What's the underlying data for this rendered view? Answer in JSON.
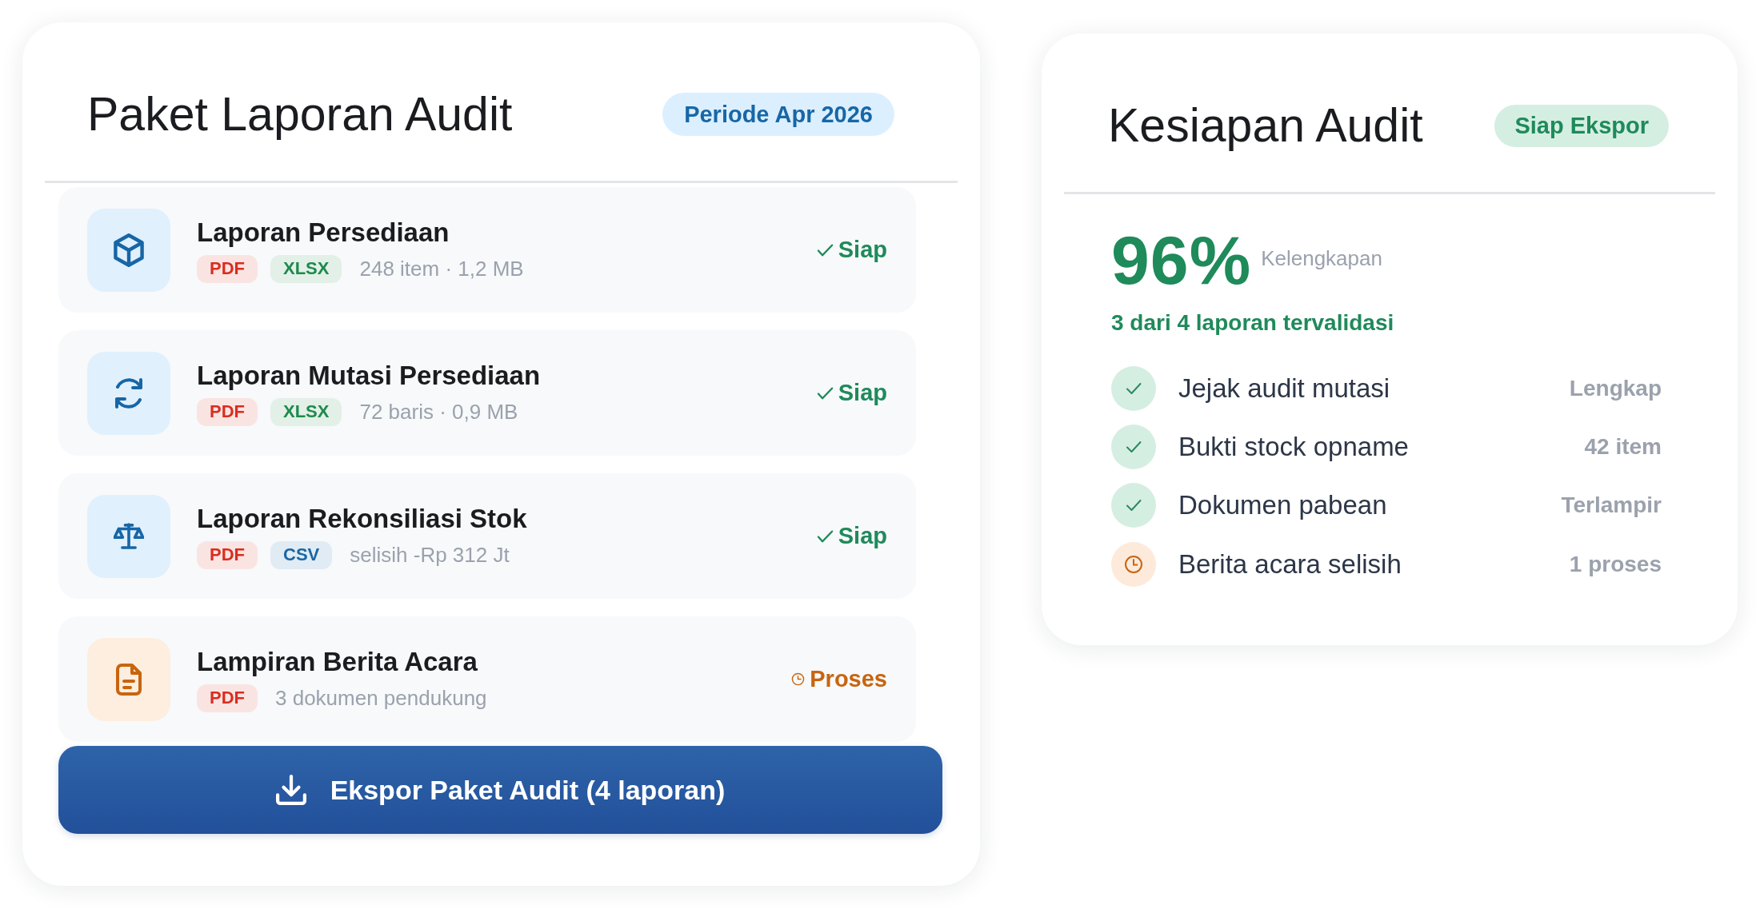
{
  "audit_package": {
    "title": "Paket Laporan Audit",
    "period": "Periode Apr 2026",
    "reports": [
      {
        "kind": "inventory",
        "name": "Laporan Persediaan",
        "tags": [
          {
            "label": "PDF",
            "color": "#d92d20"
          },
          {
            "label": "XLSX",
            "color": "#1e8a4c"
          }
        ],
        "meta": "248 item · 1,2 MB",
        "status": {
          "kind": "ready",
          "label": "Siap"
        }
      },
      {
        "kind": "mutation",
        "name": "Laporan Mutasi Persediaan",
        "tags": [
          {
            "label": "PDF",
            "color": "#d92d20"
          },
          {
            "label": "XLSX",
            "color": "#1e8a4c"
          }
        ],
        "meta": "72 baris · 0,9 MB",
        "status": {
          "kind": "ready",
          "label": "Siap"
        }
      },
      {
        "kind": "reconciliation",
        "name": "Laporan Rekonsiliasi Stok",
        "tags": [
          {
            "label": "PDF",
            "color": "#d92d20"
          },
          {
            "label": "CSV",
            "color": "#1766a6"
          }
        ],
        "meta": "selisih -Rp 312 Jt",
        "status": {
          "kind": "ready",
          "label": "Siap"
        }
      },
      {
        "kind": "attachment",
        "name": "Lampiran Berita Acara",
        "tags": [
          {
            "label": "PDF",
            "color": "#d92d20"
          }
        ],
        "meta": "3 dokumen pendukung",
        "status": {
          "kind": "pending",
          "label": "Proses"
        }
      }
    ],
    "export_button": "Ekspor Paket Audit (4 laporan)"
  },
  "readiness": {
    "title": "Kesiapan Audit",
    "badge": "Siap Ekspor",
    "score": "96%",
    "score_label": "Kelengkapan",
    "summary": "3 dari 4 laporan tervalidasi",
    "checklist": [
      {
        "kind": "done",
        "label": "Jejak audit mutasi",
        "value": "Lengkap"
      },
      {
        "kind": "done",
        "label": "Bukti stock opname",
        "value": "42 item"
      },
      {
        "kind": "done",
        "label": "Dokumen pabean",
        "value": "Terlampir"
      },
      {
        "kind": "pending",
        "label": "Berita acara selisih",
        "value": "1 proses"
      }
    ]
  }
}
